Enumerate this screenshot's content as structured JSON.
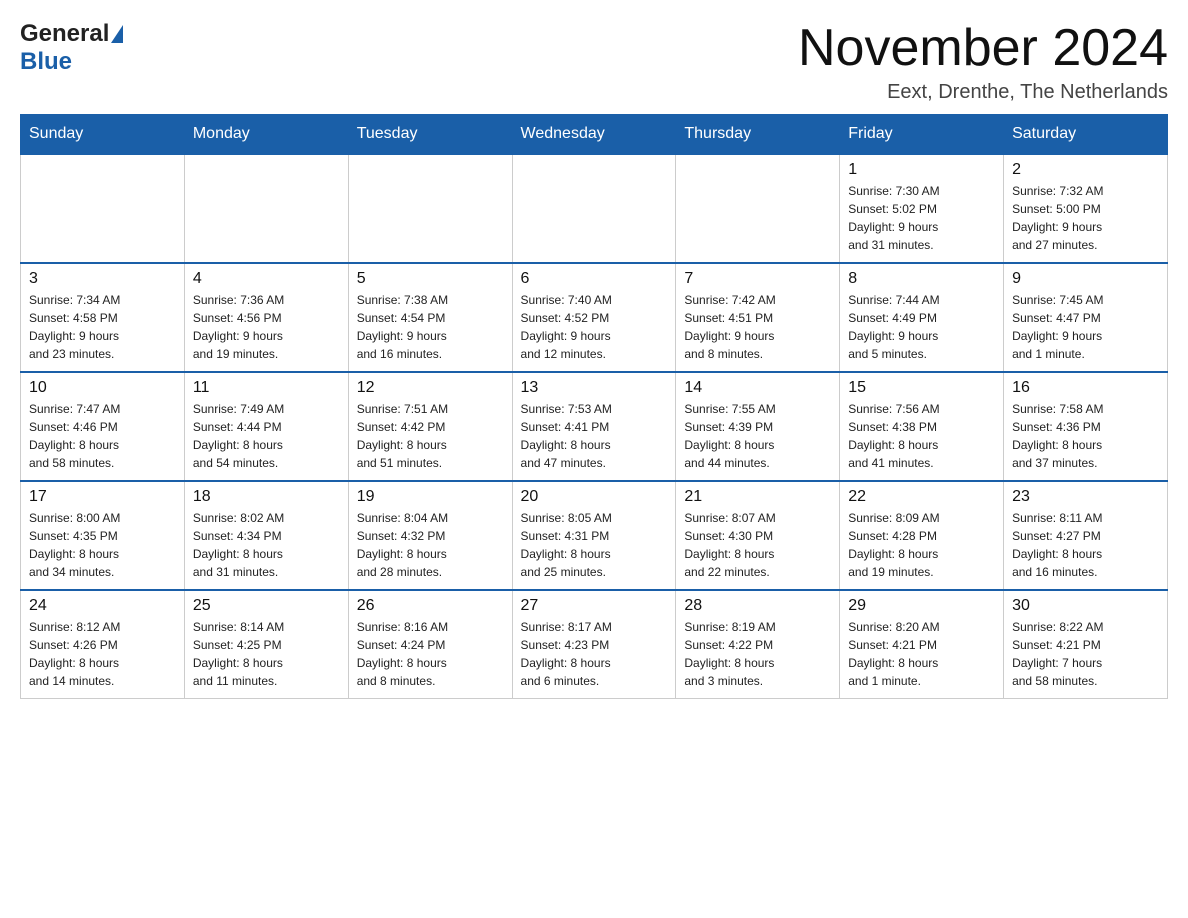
{
  "header": {
    "logo": {
      "general": "General",
      "blue": "Blue"
    },
    "title": "November 2024",
    "location": "Eext, Drenthe, The Netherlands"
  },
  "calendar": {
    "days_of_week": [
      "Sunday",
      "Monday",
      "Tuesday",
      "Wednesday",
      "Thursday",
      "Friday",
      "Saturday"
    ],
    "weeks": [
      {
        "days": [
          {
            "number": "",
            "info": ""
          },
          {
            "number": "",
            "info": ""
          },
          {
            "number": "",
            "info": ""
          },
          {
            "number": "",
            "info": ""
          },
          {
            "number": "",
            "info": ""
          },
          {
            "number": "1",
            "info": "Sunrise: 7:30 AM\nSunset: 5:02 PM\nDaylight: 9 hours\nand 31 minutes."
          },
          {
            "number": "2",
            "info": "Sunrise: 7:32 AM\nSunset: 5:00 PM\nDaylight: 9 hours\nand 27 minutes."
          }
        ]
      },
      {
        "days": [
          {
            "number": "3",
            "info": "Sunrise: 7:34 AM\nSunset: 4:58 PM\nDaylight: 9 hours\nand 23 minutes."
          },
          {
            "number": "4",
            "info": "Sunrise: 7:36 AM\nSunset: 4:56 PM\nDaylight: 9 hours\nand 19 minutes."
          },
          {
            "number": "5",
            "info": "Sunrise: 7:38 AM\nSunset: 4:54 PM\nDaylight: 9 hours\nand 16 minutes."
          },
          {
            "number": "6",
            "info": "Sunrise: 7:40 AM\nSunset: 4:52 PM\nDaylight: 9 hours\nand 12 minutes."
          },
          {
            "number": "7",
            "info": "Sunrise: 7:42 AM\nSunset: 4:51 PM\nDaylight: 9 hours\nand 8 minutes."
          },
          {
            "number": "8",
            "info": "Sunrise: 7:44 AM\nSunset: 4:49 PM\nDaylight: 9 hours\nand 5 minutes."
          },
          {
            "number": "9",
            "info": "Sunrise: 7:45 AM\nSunset: 4:47 PM\nDaylight: 9 hours\nand 1 minute."
          }
        ]
      },
      {
        "days": [
          {
            "number": "10",
            "info": "Sunrise: 7:47 AM\nSunset: 4:46 PM\nDaylight: 8 hours\nand 58 minutes."
          },
          {
            "number": "11",
            "info": "Sunrise: 7:49 AM\nSunset: 4:44 PM\nDaylight: 8 hours\nand 54 minutes."
          },
          {
            "number": "12",
            "info": "Sunrise: 7:51 AM\nSunset: 4:42 PM\nDaylight: 8 hours\nand 51 minutes."
          },
          {
            "number": "13",
            "info": "Sunrise: 7:53 AM\nSunset: 4:41 PM\nDaylight: 8 hours\nand 47 minutes."
          },
          {
            "number": "14",
            "info": "Sunrise: 7:55 AM\nSunset: 4:39 PM\nDaylight: 8 hours\nand 44 minutes."
          },
          {
            "number": "15",
            "info": "Sunrise: 7:56 AM\nSunset: 4:38 PM\nDaylight: 8 hours\nand 41 minutes."
          },
          {
            "number": "16",
            "info": "Sunrise: 7:58 AM\nSunset: 4:36 PM\nDaylight: 8 hours\nand 37 minutes."
          }
        ]
      },
      {
        "days": [
          {
            "number": "17",
            "info": "Sunrise: 8:00 AM\nSunset: 4:35 PM\nDaylight: 8 hours\nand 34 minutes."
          },
          {
            "number": "18",
            "info": "Sunrise: 8:02 AM\nSunset: 4:34 PM\nDaylight: 8 hours\nand 31 minutes."
          },
          {
            "number": "19",
            "info": "Sunrise: 8:04 AM\nSunset: 4:32 PM\nDaylight: 8 hours\nand 28 minutes."
          },
          {
            "number": "20",
            "info": "Sunrise: 8:05 AM\nSunset: 4:31 PM\nDaylight: 8 hours\nand 25 minutes."
          },
          {
            "number": "21",
            "info": "Sunrise: 8:07 AM\nSunset: 4:30 PM\nDaylight: 8 hours\nand 22 minutes."
          },
          {
            "number": "22",
            "info": "Sunrise: 8:09 AM\nSunset: 4:28 PM\nDaylight: 8 hours\nand 19 minutes."
          },
          {
            "number": "23",
            "info": "Sunrise: 8:11 AM\nSunset: 4:27 PM\nDaylight: 8 hours\nand 16 minutes."
          }
        ]
      },
      {
        "days": [
          {
            "number": "24",
            "info": "Sunrise: 8:12 AM\nSunset: 4:26 PM\nDaylight: 8 hours\nand 14 minutes."
          },
          {
            "number": "25",
            "info": "Sunrise: 8:14 AM\nSunset: 4:25 PM\nDaylight: 8 hours\nand 11 minutes."
          },
          {
            "number": "26",
            "info": "Sunrise: 8:16 AM\nSunset: 4:24 PM\nDaylight: 8 hours\nand 8 minutes."
          },
          {
            "number": "27",
            "info": "Sunrise: 8:17 AM\nSunset: 4:23 PM\nDaylight: 8 hours\nand 6 minutes."
          },
          {
            "number": "28",
            "info": "Sunrise: 8:19 AM\nSunset: 4:22 PM\nDaylight: 8 hours\nand 3 minutes."
          },
          {
            "number": "29",
            "info": "Sunrise: 8:20 AM\nSunset: 4:21 PM\nDaylight: 8 hours\nand 1 minute."
          },
          {
            "number": "30",
            "info": "Sunrise: 8:22 AM\nSunset: 4:21 PM\nDaylight: 7 hours\nand 58 minutes."
          }
        ]
      }
    ]
  }
}
